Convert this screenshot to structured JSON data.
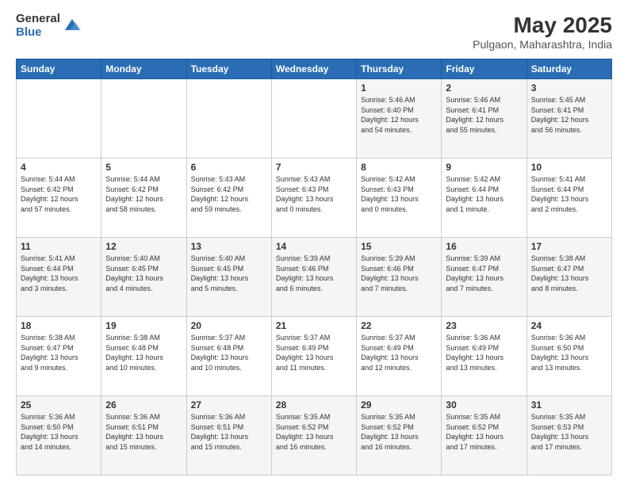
{
  "logo": {
    "general": "General",
    "blue": "Blue"
  },
  "header": {
    "month": "May 2025",
    "location": "Pulgaon, Maharashtra, India"
  },
  "weekdays": [
    "Sunday",
    "Monday",
    "Tuesday",
    "Wednesday",
    "Thursday",
    "Friday",
    "Saturday"
  ],
  "weeks": [
    [
      {
        "day": "",
        "info": ""
      },
      {
        "day": "",
        "info": ""
      },
      {
        "day": "",
        "info": ""
      },
      {
        "day": "",
        "info": ""
      },
      {
        "day": "1",
        "info": "Sunrise: 5:46 AM\nSunset: 6:40 PM\nDaylight: 12 hours\nand 54 minutes."
      },
      {
        "day": "2",
        "info": "Sunrise: 5:46 AM\nSunset: 6:41 PM\nDaylight: 12 hours\nand 55 minutes."
      },
      {
        "day": "3",
        "info": "Sunrise: 5:45 AM\nSunset: 6:41 PM\nDaylight: 12 hours\nand 56 minutes."
      }
    ],
    [
      {
        "day": "4",
        "info": "Sunrise: 5:44 AM\nSunset: 6:42 PM\nDaylight: 12 hours\nand 57 minutes."
      },
      {
        "day": "5",
        "info": "Sunrise: 5:44 AM\nSunset: 6:42 PM\nDaylight: 12 hours\nand 58 minutes."
      },
      {
        "day": "6",
        "info": "Sunrise: 5:43 AM\nSunset: 6:42 PM\nDaylight: 12 hours\nand 59 minutes."
      },
      {
        "day": "7",
        "info": "Sunrise: 5:43 AM\nSunset: 6:43 PM\nDaylight: 13 hours\nand 0 minutes."
      },
      {
        "day": "8",
        "info": "Sunrise: 5:42 AM\nSunset: 6:43 PM\nDaylight: 13 hours\nand 0 minutes."
      },
      {
        "day": "9",
        "info": "Sunrise: 5:42 AM\nSunset: 6:44 PM\nDaylight: 13 hours\nand 1 minute."
      },
      {
        "day": "10",
        "info": "Sunrise: 5:41 AM\nSunset: 6:44 PM\nDaylight: 13 hours\nand 2 minutes."
      }
    ],
    [
      {
        "day": "11",
        "info": "Sunrise: 5:41 AM\nSunset: 6:44 PM\nDaylight: 13 hours\nand 3 minutes."
      },
      {
        "day": "12",
        "info": "Sunrise: 5:40 AM\nSunset: 6:45 PM\nDaylight: 13 hours\nand 4 minutes."
      },
      {
        "day": "13",
        "info": "Sunrise: 5:40 AM\nSunset: 6:45 PM\nDaylight: 13 hours\nand 5 minutes."
      },
      {
        "day": "14",
        "info": "Sunrise: 5:39 AM\nSunset: 6:46 PM\nDaylight: 13 hours\nand 6 minutes."
      },
      {
        "day": "15",
        "info": "Sunrise: 5:39 AM\nSunset: 6:46 PM\nDaylight: 13 hours\nand 7 minutes."
      },
      {
        "day": "16",
        "info": "Sunrise: 5:39 AM\nSunset: 6:47 PM\nDaylight: 13 hours\nand 7 minutes."
      },
      {
        "day": "17",
        "info": "Sunrise: 5:38 AM\nSunset: 6:47 PM\nDaylight: 13 hours\nand 8 minutes."
      }
    ],
    [
      {
        "day": "18",
        "info": "Sunrise: 5:38 AM\nSunset: 6:47 PM\nDaylight: 13 hours\nand 9 minutes."
      },
      {
        "day": "19",
        "info": "Sunrise: 5:38 AM\nSunset: 6:48 PM\nDaylight: 13 hours\nand 10 minutes."
      },
      {
        "day": "20",
        "info": "Sunrise: 5:37 AM\nSunset: 6:48 PM\nDaylight: 13 hours\nand 10 minutes."
      },
      {
        "day": "21",
        "info": "Sunrise: 5:37 AM\nSunset: 6:49 PM\nDaylight: 13 hours\nand 11 minutes."
      },
      {
        "day": "22",
        "info": "Sunrise: 5:37 AM\nSunset: 6:49 PM\nDaylight: 13 hours\nand 12 minutes."
      },
      {
        "day": "23",
        "info": "Sunrise: 5:36 AM\nSunset: 6:49 PM\nDaylight: 13 hours\nand 13 minutes."
      },
      {
        "day": "24",
        "info": "Sunrise: 5:36 AM\nSunset: 6:50 PM\nDaylight: 13 hours\nand 13 minutes."
      }
    ],
    [
      {
        "day": "25",
        "info": "Sunrise: 5:36 AM\nSunset: 6:50 PM\nDaylight: 13 hours\nand 14 minutes."
      },
      {
        "day": "26",
        "info": "Sunrise: 5:36 AM\nSunset: 6:51 PM\nDaylight: 13 hours\nand 15 minutes."
      },
      {
        "day": "27",
        "info": "Sunrise: 5:36 AM\nSunset: 6:51 PM\nDaylight: 13 hours\nand 15 minutes."
      },
      {
        "day": "28",
        "info": "Sunrise: 5:35 AM\nSunset: 6:52 PM\nDaylight: 13 hours\nand 16 minutes."
      },
      {
        "day": "29",
        "info": "Sunrise: 5:35 AM\nSunset: 6:52 PM\nDaylight: 13 hours\nand 16 minutes."
      },
      {
        "day": "30",
        "info": "Sunrise: 5:35 AM\nSunset: 6:52 PM\nDaylight: 13 hours\nand 17 minutes."
      },
      {
        "day": "31",
        "info": "Sunrise: 5:35 AM\nSunset: 6:53 PM\nDaylight: 13 hours\nand 17 minutes."
      }
    ]
  ]
}
